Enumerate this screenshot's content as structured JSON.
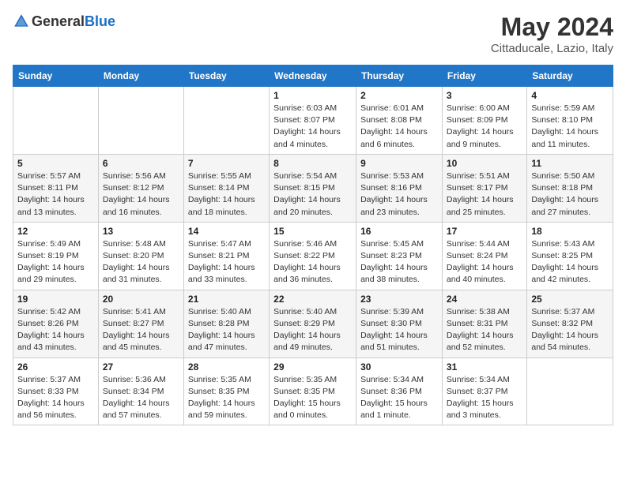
{
  "header": {
    "logo_general": "General",
    "logo_blue": "Blue",
    "month_year": "May 2024",
    "location": "Cittaducale, Lazio, Italy"
  },
  "days_of_week": [
    "Sunday",
    "Monday",
    "Tuesday",
    "Wednesday",
    "Thursday",
    "Friday",
    "Saturday"
  ],
  "weeks": [
    [
      {
        "day": "",
        "sunrise": "",
        "sunset": "",
        "daylight": ""
      },
      {
        "day": "",
        "sunrise": "",
        "sunset": "",
        "daylight": ""
      },
      {
        "day": "",
        "sunrise": "",
        "sunset": "",
        "daylight": ""
      },
      {
        "day": "1",
        "sunrise": "Sunrise: 6:03 AM",
        "sunset": "Sunset: 8:07 PM",
        "daylight": "Daylight: 14 hours and 4 minutes."
      },
      {
        "day": "2",
        "sunrise": "Sunrise: 6:01 AM",
        "sunset": "Sunset: 8:08 PM",
        "daylight": "Daylight: 14 hours and 6 minutes."
      },
      {
        "day": "3",
        "sunrise": "Sunrise: 6:00 AM",
        "sunset": "Sunset: 8:09 PM",
        "daylight": "Daylight: 14 hours and 9 minutes."
      },
      {
        "day": "4",
        "sunrise": "Sunrise: 5:59 AM",
        "sunset": "Sunset: 8:10 PM",
        "daylight": "Daylight: 14 hours and 11 minutes."
      }
    ],
    [
      {
        "day": "5",
        "sunrise": "Sunrise: 5:57 AM",
        "sunset": "Sunset: 8:11 PM",
        "daylight": "Daylight: 14 hours and 13 minutes."
      },
      {
        "day": "6",
        "sunrise": "Sunrise: 5:56 AM",
        "sunset": "Sunset: 8:12 PM",
        "daylight": "Daylight: 14 hours and 16 minutes."
      },
      {
        "day": "7",
        "sunrise": "Sunrise: 5:55 AM",
        "sunset": "Sunset: 8:14 PM",
        "daylight": "Daylight: 14 hours and 18 minutes."
      },
      {
        "day": "8",
        "sunrise": "Sunrise: 5:54 AM",
        "sunset": "Sunset: 8:15 PM",
        "daylight": "Daylight: 14 hours and 20 minutes."
      },
      {
        "day": "9",
        "sunrise": "Sunrise: 5:53 AM",
        "sunset": "Sunset: 8:16 PM",
        "daylight": "Daylight: 14 hours and 23 minutes."
      },
      {
        "day": "10",
        "sunrise": "Sunrise: 5:51 AM",
        "sunset": "Sunset: 8:17 PM",
        "daylight": "Daylight: 14 hours and 25 minutes."
      },
      {
        "day": "11",
        "sunrise": "Sunrise: 5:50 AM",
        "sunset": "Sunset: 8:18 PM",
        "daylight": "Daylight: 14 hours and 27 minutes."
      }
    ],
    [
      {
        "day": "12",
        "sunrise": "Sunrise: 5:49 AM",
        "sunset": "Sunset: 8:19 PM",
        "daylight": "Daylight: 14 hours and 29 minutes."
      },
      {
        "day": "13",
        "sunrise": "Sunrise: 5:48 AM",
        "sunset": "Sunset: 8:20 PM",
        "daylight": "Daylight: 14 hours and 31 minutes."
      },
      {
        "day": "14",
        "sunrise": "Sunrise: 5:47 AM",
        "sunset": "Sunset: 8:21 PM",
        "daylight": "Daylight: 14 hours and 33 minutes."
      },
      {
        "day": "15",
        "sunrise": "Sunrise: 5:46 AM",
        "sunset": "Sunset: 8:22 PM",
        "daylight": "Daylight: 14 hours and 36 minutes."
      },
      {
        "day": "16",
        "sunrise": "Sunrise: 5:45 AM",
        "sunset": "Sunset: 8:23 PM",
        "daylight": "Daylight: 14 hours and 38 minutes."
      },
      {
        "day": "17",
        "sunrise": "Sunrise: 5:44 AM",
        "sunset": "Sunset: 8:24 PM",
        "daylight": "Daylight: 14 hours and 40 minutes."
      },
      {
        "day": "18",
        "sunrise": "Sunrise: 5:43 AM",
        "sunset": "Sunset: 8:25 PM",
        "daylight": "Daylight: 14 hours and 42 minutes."
      }
    ],
    [
      {
        "day": "19",
        "sunrise": "Sunrise: 5:42 AM",
        "sunset": "Sunset: 8:26 PM",
        "daylight": "Daylight: 14 hours and 43 minutes."
      },
      {
        "day": "20",
        "sunrise": "Sunrise: 5:41 AM",
        "sunset": "Sunset: 8:27 PM",
        "daylight": "Daylight: 14 hours and 45 minutes."
      },
      {
        "day": "21",
        "sunrise": "Sunrise: 5:40 AM",
        "sunset": "Sunset: 8:28 PM",
        "daylight": "Daylight: 14 hours and 47 minutes."
      },
      {
        "day": "22",
        "sunrise": "Sunrise: 5:40 AM",
        "sunset": "Sunset: 8:29 PM",
        "daylight": "Daylight: 14 hours and 49 minutes."
      },
      {
        "day": "23",
        "sunrise": "Sunrise: 5:39 AM",
        "sunset": "Sunset: 8:30 PM",
        "daylight": "Daylight: 14 hours and 51 minutes."
      },
      {
        "day": "24",
        "sunrise": "Sunrise: 5:38 AM",
        "sunset": "Sunset: 8:31 PM",
        "daylight": "Daylight: 14 hours and 52 minutes."
      },
      {
        "day": "25",
        "sunrise": "Sunrise: 5:37 AM",
        "sunset": "Sunset: 8:32 PM",
        "daylight": "Daylight: 14 hours and 54 minutes."
      }
    ],
    [
      {
        "day": "26",
        "sunrise": "Sunrise: 5:37 AM",
        "sunset": "Sunset: 8:33 PM",
        "daylight": "Daylight: 14 hours and 56 minutes."
      },
      {
        "day": "27",
        "sunrise": "Sunrise: 5:36 AM",
        "sunset": "Sunset: 8:34 PM",
        "daylight": "Daylight: 14 hours and 57 minutes."
      },
      {
        "day": "28",
        "sunrise": "Sunrise: 5:35 AM",
        "sunset": "Sunset: 8:35 PM",
        "daylight": "Daylight: 14 hours and 59 minutes."
      },
      {
        "day": "29",
        "sunrise": "Sunrise: 5:35 AM",
        "sunset": "Sunset: 8:35 PM",
        "daylight": "Daylight: 15 hours and 0 minutes."
      },
      {
        "day": "30",
        "sunrise": "Sunrise: 5:34 AM",
        "sunset": "Sunset: 8:36 PM",
        "daylight": "Daylight: 15 hours and 1 minute."
      },
      {
        "day": "31",
        "sunrise": "Sunrise: 5:34 AM",
        "sunset": "Sunset: 8:37 PM",
        "daylight": "Daylight: 15 hours and 3 minutes."
      },
      {
        "day": "",
        "sunrise": "",
        "sunset": "",
        "daylight": ""
      }
    ]
  ]
}
